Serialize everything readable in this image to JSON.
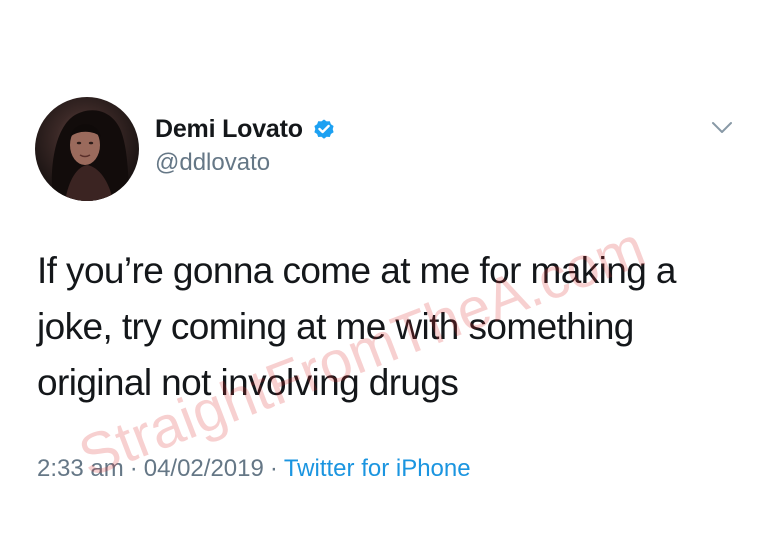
{
  "user": {
    "display_name": "Demi Lovato",
    "handle": "@ddlovato",
    "verified": true,
    "avatar_icon": "profile-photo"
  },
  "tweet": {
    "text": "If you’re gonna come at me for making a\njoke, try coming at me with something\noriginal not involving drugs",
    "time": "2:33 am",
    "separator": "·",
    "date": "04/02/2019",
    "source": "Twitter for iPhone"
  },
  "watermark": {
    "text": "StraightFromTheA.com"
  },
  "colors": {
    "text_primary": "#14171a",
    "text_secondary": "#657786",
    "verified_blue": "#1da1f2",
    "link_blue": "#1b95e0",
    "watermark_red": "#dc2828"
  },
  "icons": {
    "verified": "verified-badge-icon",
    "menu": "chevron-down-icon"
  }
}
